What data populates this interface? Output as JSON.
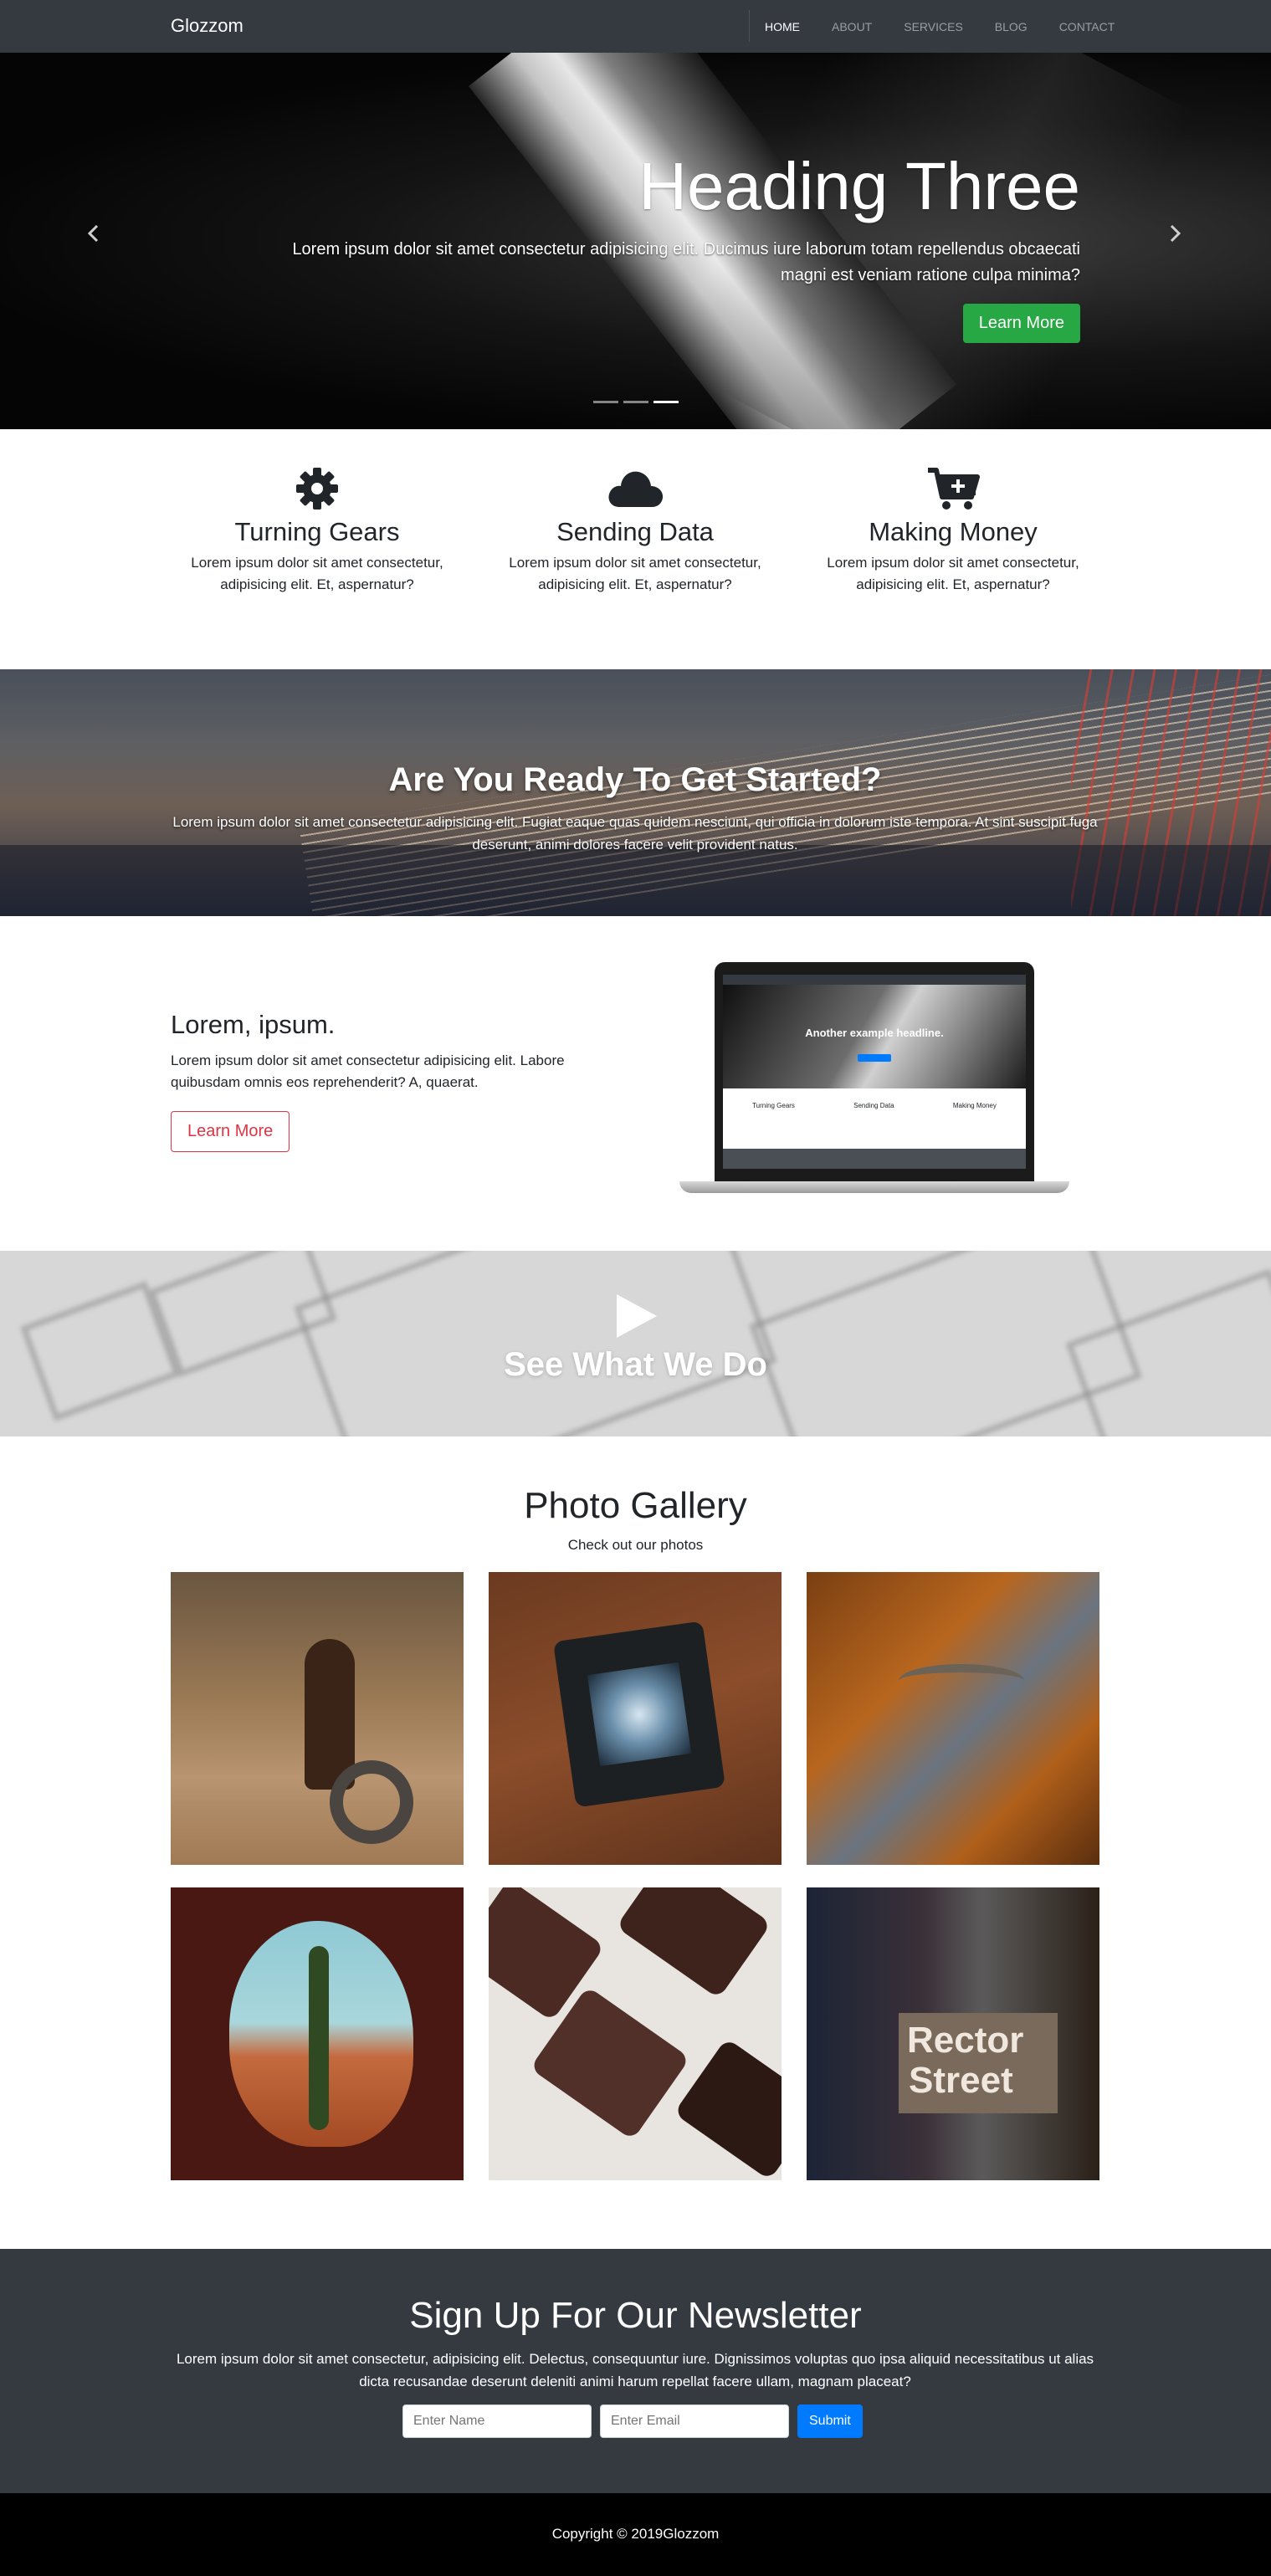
{
  "nav": {
    "brand": "Glozzom",
    "links": [
      "HOME",
      "ABOUT",
      "SERVICES",
      "BLOG",
      "CONTACT"
    ]
  },
  "hero": {
    "title": "Heading Three",
    "text_line1": "Lorem ipsum dolor sit amet consectetur adipisicing elit. Ducimus iure laborum totam repellendus obcaecati",
    "text_line2": "magni est veniam ratione culpa minima?",
    "button": "Learn More",
    "prev_glyph": "‹",
    "next_glyph": "›",
    "indicator_count": 3
  },
  "features": [
    {
      "icon": "gear-icon",
      "title": "Turning Gears",
      "text": "Lorem ipsum dolor sit amet consectetur, adipisicing elit. Et, aspernatur?"
    },
    {
      "icon": "cloud-icon",
      "title": "Sending Data",
      "text": "Lorem ipsum dolor sit amet consectetur, adipisicing elit. Et, aspernatur?"
    },
    {
      "icon": "cart-icon",
      "title": "Making Money",
      "text": "Lorem ipsum dolor sit amet consectetur, adipisicing elit. Et, aspernatur?"
    }
  ],
  "cta": {
    "title": "Are You Ready To Get Started?",
    "text": "Lorem ipsum dolor sit amet consectetur adipisicing elit. Fugiat eaque quas quidem nesciunt, qui officia in dolorum iste tempora. At sint suscipit fuga deserunt, animi dolores facere velit provident natus."
  },
  "split": {
    "title": "Lorem, ipsum.",
    "text": "Lorem ipsum dolor sit amet consectetur adipisicing elit. Labore quibusdam omnis eos reprehenderit? A, quaerat.",
    "button": "Learn More",
    "laptop_headline": "Another example headline.",
    "laptop_features": [
      "Turning Gears",
      "Sending Data",
      "Making Money"
    ]
  },
  "video": {
    "title": "See What We Do",
    "icon": "play-icon"
  },
  "gallery": {
    "title": "Photo Gallery",
    "subtitle": "Check out our photos",
    "images": [
      "child-with-wheel-photo",
      "camera-in-hand-photo",
      "river-bridge-photo",
      "cave-tree-photo",
      "chocolate-photo",
      "rector-street-sign-photo"
    ],
    "sign_text_1": "Rector",
    "sign_text_2": "Street"
  },
  "newsletter": {
    "title": "Sign Up For Our Newsletter",
    "text": "Lorem ipsum dolor sit amet consectetur, adipisicing elit. Delectus, consequuntur iure. Dignissimos voluptas quo ipsa aliquid necessitatibus ut alias dicta recusandae deserunt deleniti animi harum repellat facere ullam, magnam placeat?",
    "name_placeholder": "Enter Name",
    "email_placeholder": "Enter Email",
    "submit": "Submit"
  },
  "footer": {
    "copyright": "Copyright © 2019Glozzom"
  },
  "colors": {
    "nav_bg": "#343a40",
    "success": "#28a745",
    "danger": "#dc3545",
    "primary": "#007bff",
    "footer_bg": "#000000"
  }
}
